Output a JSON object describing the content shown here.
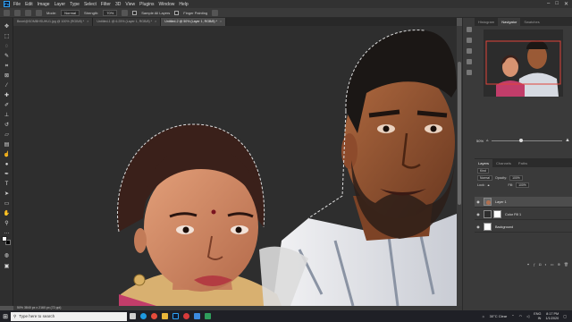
{
  "app": {
    "logo": "Ps",
    "menu": [
      "File",
      "Edit",
      "Image",
      "Layer",
      "Type",
      "Select",
      "Filter",
      "3D",
      "View",
      "Plugins",
      "Window",
      "Help"
    ],
    "window_controls": [
      "–",
      "□",
      "✕"
    ]
  },
  "options": {
    "mode_label": "Mode:",
    "mode_value": "Normal",
    "strength_label": "Strength:",
    "strength_value": "70%",
    "sample_label": "Sample All Layers",
    "finger_label": "Finger Painting"
  },
  "tabs": [
    {
      "label": "Untitled-2 @ 50% (Layer 1, RGB/8) *",
      "active": true
    },
    {
      "label": "Untitled-1 @ 6.25% (Layer 1, RGB/8) *",
      "active": false
    },
    {
      "label": "Bezel@SOMBHSUHU1.jpg @ 100% (RGB/8) *",
      "active": false
    }
  ],
  "tools": [
    "move-tool",
    "marquee-tool",
    "lasso-tool",
    "quick-select-tool",
    "crop-tool",
    "frame-tool",
    "eyedropper-tool",
    "healing-tool",
    "brush-tool",
    "stamp-tool",
    "history-brush-tool",
    "eraser-tool",
    "gradient-tool",
    "blur-tool",
    "dodge-tool",
    "pen-tool",
    "type-tool",
    "path-select-tool",
    "shape-tool",
    "hand-tool",
    "zoom-tool"
  ],
  "colors": {
    "foreground": "#ffffff",
    "background": "#000000",
    "accent": "#2fa3f6"
  },
  "status": "50%      3840 px x 2160 px (72 ppi)",
  "panels": {
    "top_tabs": [
      "Histogram",
      "Navigator",
      "Swatches"
    ],
    "zoom": "50%",
    "layer_tabs": [
      "Layers",
      "Channels",
      "Paths"
    ],
    "kind_label": "Kind",
    "blend_mode": "Normal",
    "opacity_label": "Opacity:",
    "opacity_value": "100%",
    "lock_label": "Lock:",
    "fill_label": "Fill:",
    "fill_value": "100%",
    "layers": [
      {
        "name": "Layer 1",
        "selected": true
      },
      {
        "name": "Color Fill 1",
        "selected": false
      },
      {
        "name": "Background",
        "selected": false
      }
    ]
  },
  "taskbar": {
    "search_placeholder": "Type here to search",
    "weather": "30°C  Clear",
    "lang": "ENG",
    "region": "IN",
    "time": "8:17 PM",
    "date": "1/1/2020"
  }
}
